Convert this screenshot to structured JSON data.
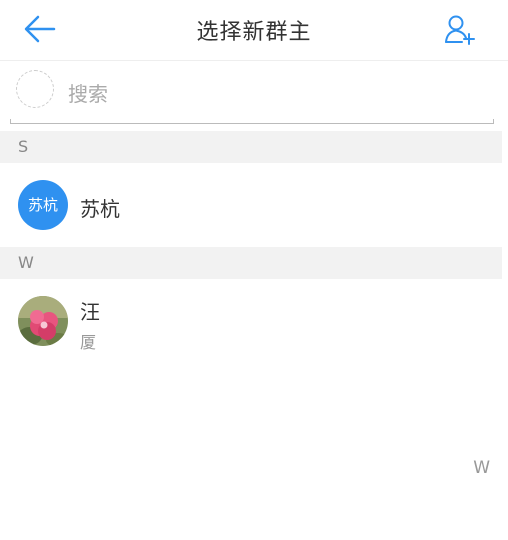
{
  "header": {
    "title": "选择新群主",
    "back_icon": "arrow-left-icon",
    "add_icon": "add-user-icon",
    "accent": "#2f91f0"
  },
  "search": {
    "placeholder": "搜索"
  },
  "sections": [
    {
      "letter": "S",
      "contacts": [
        {
          "name": "苏杭",
          "avatar_text": "苏杭",
          "avatar_color": "#2f91f0"
        }
      ]
    },
    {
      "letter": "W",
      "contacts": [
        {
          "name": "汪",
          "sub": "厦",
          "avatar_icon": "flower-photo-icon"
        }
      ]
    }
  ],
  "index_bar": {
    "letter": "W"
  }
}
